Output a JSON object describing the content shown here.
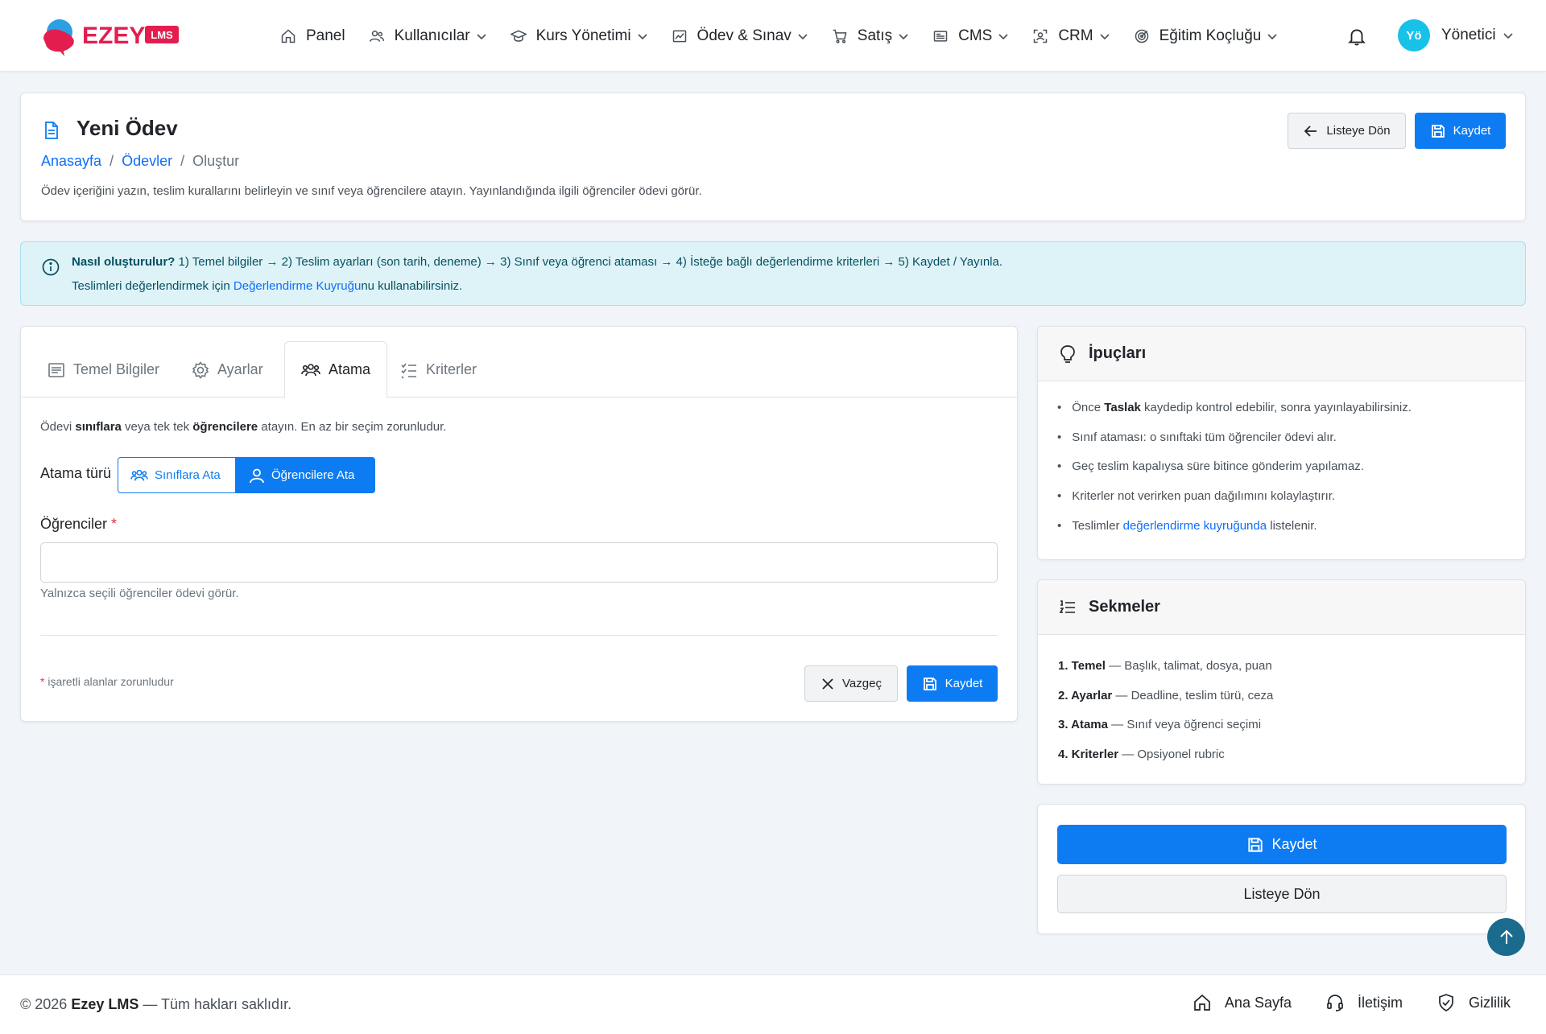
{
  "brand": {
    "name": "EZEY",
    "badge": "LMS",
    "colors": {
      "primary": "#0d7cf2",
      "brand_red": "#e31e4f",
      "brand_blue": "#2b9fe3",
      "info_bg": "#def3f8",
      "avatar": "#17c1e8"
    }
  },
  "nav": {
    "items": [
      {
        "label": "Panel",
        "icon": "home-icon",
        "dropdown": false
      },
      {
        "label": "Kullanıcılar",
        "icon": "users-icon",
        "dropdown": true
      },
      {
        "label": "Kurs Yönetimi",
        "icon": "graduation-cap-icon",
        "dropdown": true
      },
      {
        "label": "Ödev & Sınav",
        "icon": "chart-board-icon",
        "dropdown": true
      },
      {
        "label": "Satış",
        "icon": "cart-icon",
        "dropdown": true
      },
      {
        "label": "CMS",
        "icon": "newspaper-icon",
        "dropdown": true
      },
      {
        "label": "CRM",
        "icon": "person-scan-icon",
        "dropdown": true
      },
      {
        "label": "Eğitim Koçluğu",
        "icon": "target-icon",
        "dropdown": true
      }
    ],
    "user": {
      "initials": "Yö",
      "name": "Yönetici"
    }
  },
  "header": {
    "title": "Yeni Ödev",
    "breadcrumb": [
      "Anasayfa",
      "Ödevler",
      "Oluştur"
    ],
    "description": "Ödev içeriğini yazın, teslim kurallarını belirleyin ve sınıf veya öğrencilere atayın. Yayınlandığında ilgili öğrenciler ödevi görür.",
    "back_label": "Listeye Dön",
    "save_label": "Kaydet"
  },
  "alert": {
    "title": "Nasıl oluşturulur?",
    "steps": " 1) Temel bilgiler → 2) Teslim ayarları (son tarih, deneme) → 3) Sınıf veya öğrenci ataması → 4) İsteğe bağlı değerlendirme kriterleri → 5) Kaydet / Yayınla.",
    "line2_pre": "Teslimleri değerlendirmek için ",
    "line2_link": "Değerlendirme Kuyruğu",
    "line2_post": "nu kullanabilirsiniz."
  },
  "tabs": [
    {
      "label": "Temel Bilgiler",
      "active": false
    },
    {
      "label": "Ayarlar",
      "active": false
    },
    {
      "label": "Atama",
      "active": true
    },
    {
      "label": "Kriterler",
      "active": false
    }
  ],
  "assign": {
    "desc_1": "Ödevi ",
    "desc_b1": "sınıflara",
    "desc_2": " veya tek tek ",
    "desc_b2": "öğrencilere",
    "desc_3": " atayın. En az bir seçim zorunludur.",
    "type_label": "Atama türü",
    "option_classes": "Sınıflara Ata",
    "option_students": "Öğrencilere Ata",
    "selected": "Öğrencilere Ata",
    "students_label": "Öğrenciler",
    "required_mark": "*",
    "students_value": "",
    "students_hint": "Yalnızca seçili öğrenciler ödevi görür.",
    "required_note": "işaretli alanlar zorunludur",
    "cancel_label": "Vazgeç",
    "save_label": "Kaydet"
  },
  "tips": {
    "title": "İpuçları",
    "items": [
      {
        "pre": "Önce ",
        "bold": "Taslak",
        "post": " kaydedip kontrol edebilir, sonra yayınlayabilirsiniz."
      },
      {
        "pre": "Sınıf ataması: o sınıftaki tüm öğrenciler ödevi alır.",
        "bold": "",
        "post": ""
      },
      {
        "pre": "Geç teslim kapalıysa süre bitince gönderim yapılamaz.",
        "bold": "",
        "post": ""
      },
      {
        "pre": "Kriterler not verirken puan dağılımını kolaylaştırır.",
        "bold": "",
        "post": ""
      },
      {
        "pre": "Teslimler ",
        "link": "değerlendirme kuyruğunda",
        "post": " listelenir."
      }
    ]
  },
  "sections": {
    "title": "Sekmeler",
    "items": [
      {
        "bold": "1. Temel",
        "text": " — Başlık, talimat, dosya, puan"
      },
      {
        "bold": "2. Ayarlar",
        "text": " — Deadline, teslim türü, ceza"
      },
      {
        "bold": "3. Atama",
        "text": " — Sınıf veya öğrenci seçimi"
      },
      {
        "bold": "4. Kriterler",
        "text": " — Opsiyonel rubric"
      }
    ]
  },
  "actions": {
    "save_label": "Kaydet",
    "back_label": "Listeye Dön"
  },
  "footer": {
    "copy_pre": "© 2026 ",
    "copy_brand": "Ezey LMS",
    "copy_post": " — Tüm hakları saklıdır.",
    "links": [
      {
        "label": "Ana Sayfa",
        "icon": "home-icon"
      },
      {
        "label": "İletişim",
        "icon": "headset-icon"
      },
      {
        "label": "Gizlilik",
        "icon": "shield-check-icon"
      }
    ]
  }
}
